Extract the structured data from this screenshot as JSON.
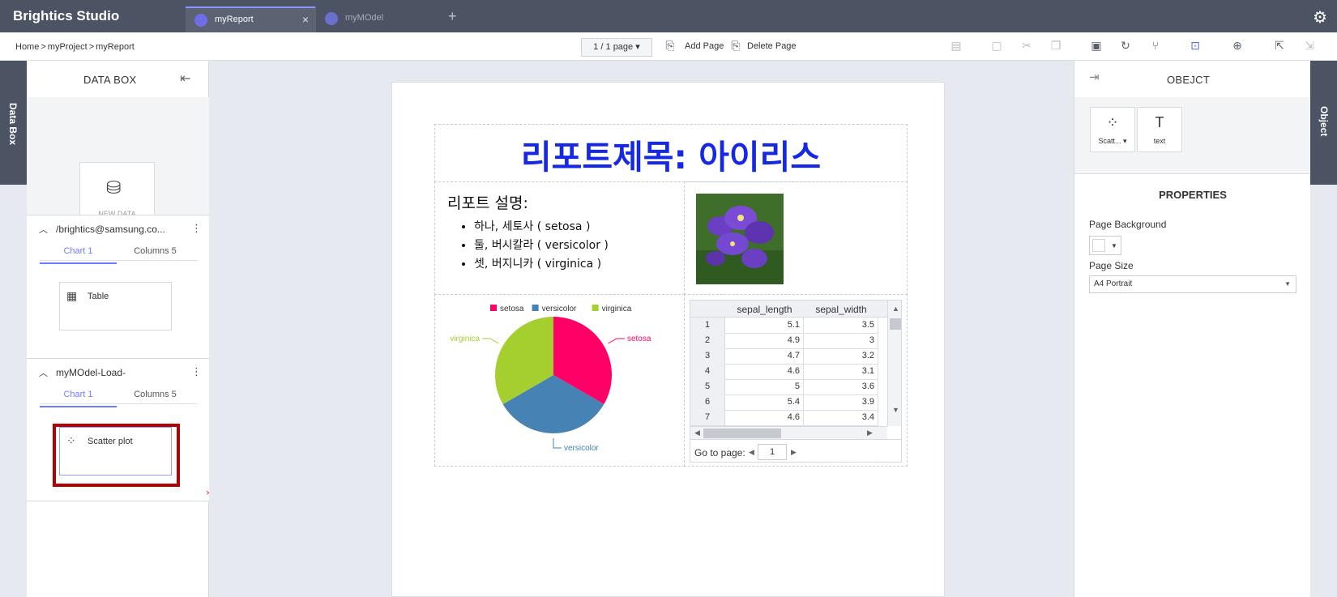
{
  "app": {
    "title": "Brightics Studio",
    "tabs": [
      {
        "label": "myReport",
        "active": true
      },
      {
        "label": "myMOdel",
        "active": false
      }
    ]
  },
  "toolbar": {
    "breadcrumb": [
      "Home",
      "myProject",
      "myReport"
    ],
    "page_selector": "1 / 1 page",
    "add_page": "Add Page",
    "delete_page": "Delete Page"
  },
  "sidebar": {
    "left_tab": "Data Box",
    "title": "DATA BOX",
    "new_data_label": "NEW DATA",
    "sections": [
      {
        "title": "/brightics@samsung.co...",
        "tabs": [
          "Chart 1",
          "Columns 5"
        ],
        "item": "Table"
      },
      {
        "title": "myMOdel-Load-",
        "tabs": [
          "Chart 1",
          "Columns 5"
        ],
        "item": "Scatter plot"
      }
    ]
  },
  "report": {
    "title": "리포트제목: 아이리스",
    "desc_heading": "리포트 설명:",
    "desc_items": [
      "하나, 세토사 ( setosa )",
      "둘, 버시칼라 ( versicolor )",
      "셋, 버지니카 ( virginica )"
    ]
  },
  "chart_data": {
    "type": "pie",
    "categories": [
      "setosa",
      "versicolor",
      "virginica"
    ],
    "values": [
      50,
      50,
      50
    ],
    "colors": [
      "#ff0066",
      "#4682b4",
      "#a4cf2e"
    ],
    "legend_position": "top"
  },
  "table": {
    "columns": [
      "sepal_length",
      "sepal_width"
    ],
    "rows": [
      {
        "idx": "1",
        "sepal_length": "5.1",
        "sepal_width": "3.5"
      },
      {
        "idx": "2",
        "sepal_length": "4.9",
        "sepal_width": "3"
      },
      {
        "idx": "3",
        "sepal_length": "4.7",
        "sepal_width": "3.2"
      },
      {
        "idx": "4",
        "sepal_length": "4.6",
        "sepal_width": "3.1"
      },
      {
        "idx": "5",
        "sepal_length": "5",
        "sepal_width": "3.6"
      },
      {
        "idx": "6",
        "sepal_length": "5.4",
        "sepal_width": "3.9"
      },
      {
        "idx": "7",
        "sepal_length": "4.6",
        "sepal_width": "3.4"
      }
    ],
    "goto_label": "Go to page:",
    "page_value": "1"
  },
  "objpanel": {
    "right_tab": "Object",
    "title": "OBEJCT",
    "objects": [
      {
        "label": "Scatt...",
        "icon": "scatter-icon"
      },
      {
        "label": "text",
        "icon": "text-icon"
      }
    ],
    "properties_title": "PROPERTIES",
    "page_bg_label": "Page Background",
    "page_size_label": "Page Size",
    "page_size_value": "A4 Portrait"
  },
  "colors": {
    "topbar": "#4c5362",
    "accent": "#6b7cff",
    "title_blue": "#1428e6",
    "highlight": "#b30000"
  }
}
